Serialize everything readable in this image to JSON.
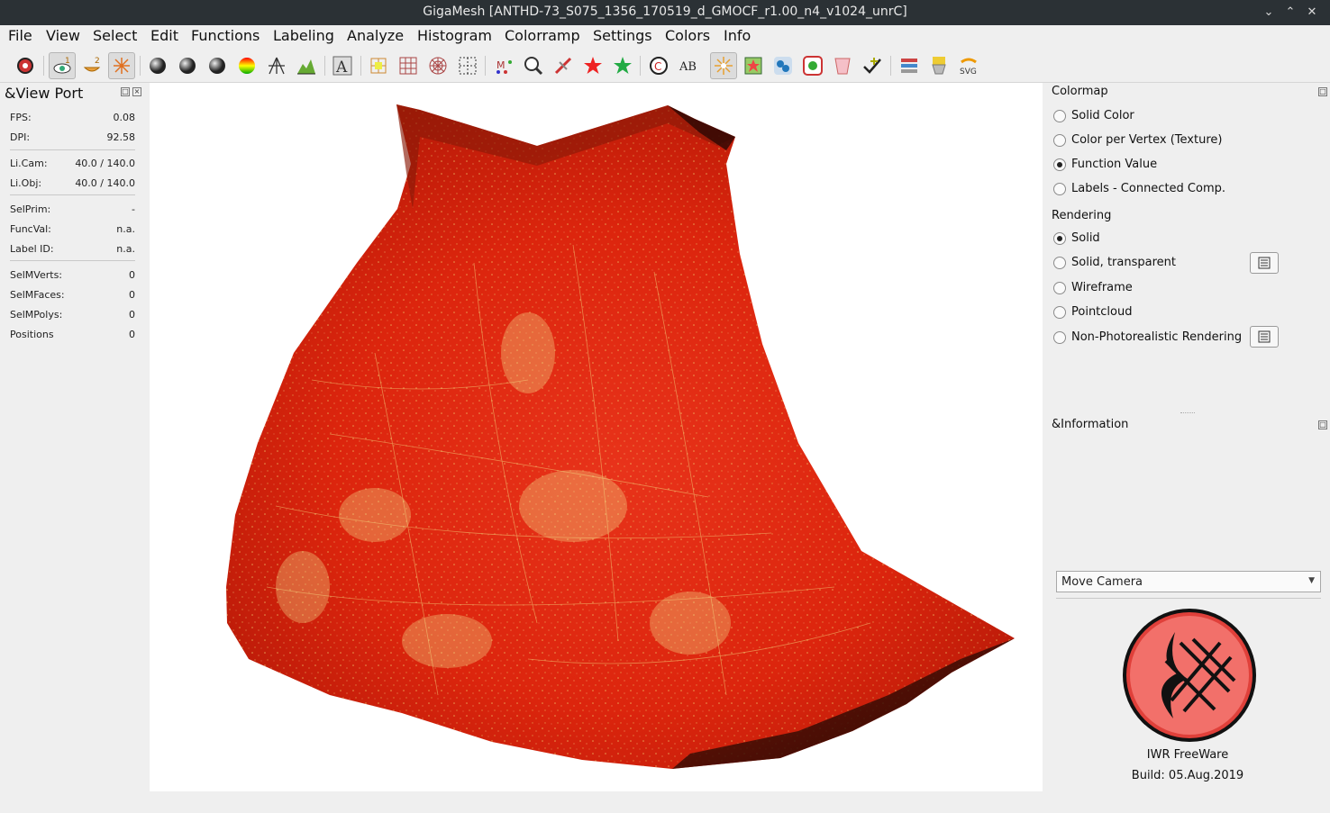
{
  "window": {
    "title": "GigaMesh [ANTHD-73_S075_1356_170519_d_GMOCF_r1.00_n4_v1024_unrC]",
    "controls": [
      "minimize-icon",
      "maximize-icon",
      "close-icon"
    ]
  },
  "menu": [
    "File",
    "View",
    "Select",
    "Edit",
    "Functions",
    "Labeling",
    "Analyze",
    "Histogram",
    "Colorramp",
    "Settings",
    "Colors",
    "Info"
  ],
  "toolbar": {
    "icons": [
      "reset-view-icon",
      "view-1-icon",
      "view-2-icon",
      "view-star-icon",
      "sphere-m-icon",
      "sphere-d-icon",
      "sphere-s-icon",
      "sphere-color-icon",
      "tripod-light-icon",
      "mountain-histogram-icon",
      "text-a-icon",
      "grid-cross-icon",
      "grid-icon",
      "polar-grid-icon",
      "dotted-grid-icon",
      "labels-ab-icon",
      "search-abc-icon",
      "broken-link-icon",
      "red-star-icon",
      "green-star-icon",
      "sheriff-star-icon",
      "ab-label-icon",
      "light-burst-icon",
      "green-box-icon",
      "bubbles-icon",
      "gear-box-icon",
      "cup-icon",
      "check-pencil-icon",
      "layers-icon",
      "flask-icon",
      "svg-export-icon"
    ]
  },
  "viewport_panel": {
    "title": "&View Port",
    "rows": [
      {
        "k": "FPS:",
        "v": "0.08"
      },
      {
        "k": "DPI:",
        "v": "92.58"
      },
      {
        "k": "Li.Cam:",
        "v": "40.0 / 140.0"
      },
      {
        "k": "Li.Obj:",
        "v": "40.0 / 140.0"
      },
      {
        "k": "SelPrim:",
        "v": "-"
      },
      {
        "k": "FuncVal:",
        "v": "n.a."
      },
      {
        "k": "Label ID:",
        "v": "n.a."
      },
      {
        "k": "SelMVerts:",
        "v": "0"
      },
      {
        "k": "SelMFaces:",
        "v": "0"
      },
      {
        "k": "SelMPolys:",
        "v": "0"
      },
      {
        "k": "Positions",
        "v": "0"
      }
    ]
  },
  "colormap": {
    "title": "Colormap",
    "options": [
      "Solid Color",
      "Color per Vertex (Texture)",
      "Function Value",
      "Labels - Connected Comp."
    ],
    "selected": "Function Value"
  },
  "rendering": {
    "title": "Rendering",
    "options": [
      "Solid",
      "Solid, transparent",
      "Wireframe",
      "Pointcloud",
      "Non-Photorealistic Rendering"
    ],
    "selected": "Solid"
  },
  "information": {
    "title": "&Information",
    "mode_value": "Move Camera",
    "brand": "IWR FreeWare",
    "build": "Build: 05.Aug.2019"
  },
  "colors": {
    "mesh_main": "#e8260e",
    "mesh_dark": "#3a0c04",
    "speckle": "#e8c96a",
    "logo_red": "#e0403a"
  }
}
